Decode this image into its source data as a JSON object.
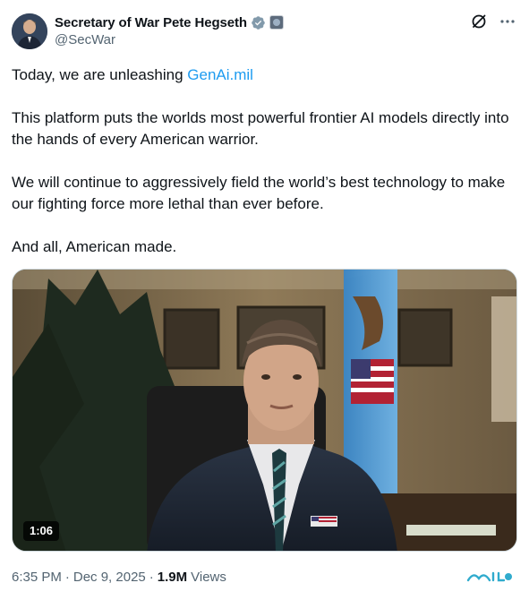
{
  "author": {
    "display_name": "Secretary of War Pete Hegseth",
    "handle": "@SecWar",
    "verified_icon": "verified-badge-icon",
    "affiliate_icon": "affiliate-badge-icon",
    "verified_color": "#829aab"
  },
  "tweet": {
    "paragraph1_prefix": "Today, we are unleashing ",
    "paragraph1_link": "GenAi.mil",
    "paragraph2": "This platform puts the worlds most powerful frontier AI models directly into the hands of every American warrior.",
    "paragraph3": "We will continue to aggressively field the world’s best technology to make our fighting force more lethal than ever before.",
    "paragraph4": "And all, American made."
  },
  "media": {
    "type": "video",
    "duration": "1:06"
  },
  "meta": {
    "time": "6:35 PM",
    "separator": "·",
    "date": "Dec 9, 2025",
    "views_count": "1.9M",
    "views_label": "Views"
  },
  "colors": {
    "text": "#0f1419",
    "secondary_text": "#536471",
    "link": "#1d9bf0",
    "border": "#cfd9de"
  }
}
